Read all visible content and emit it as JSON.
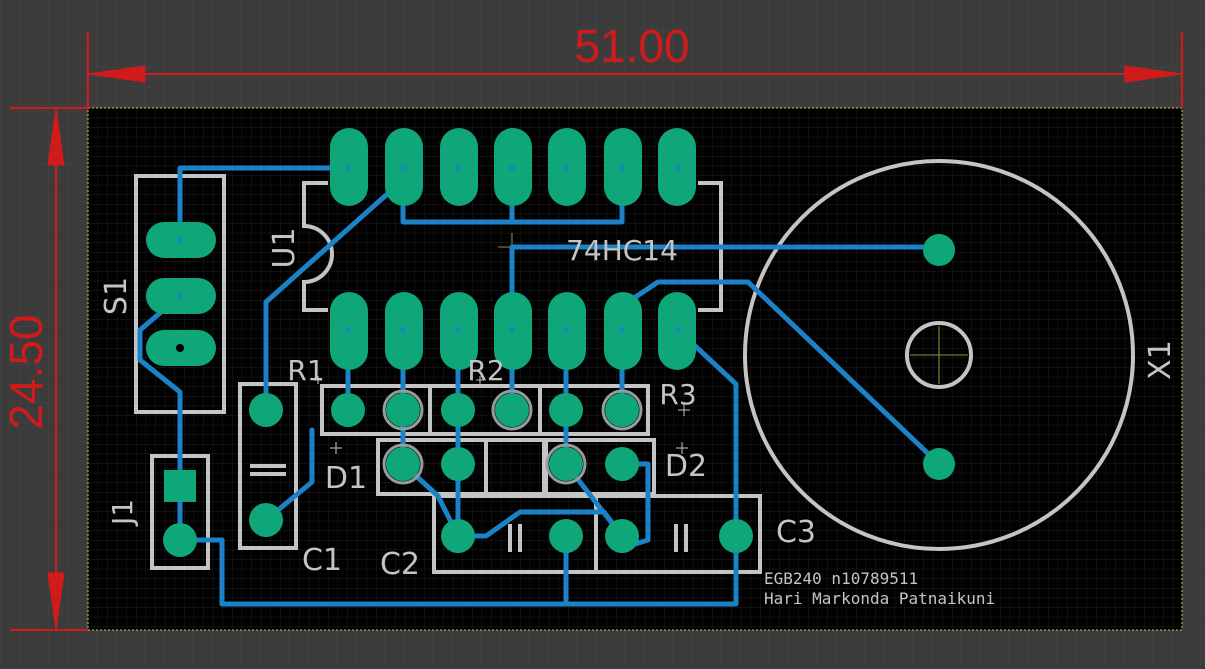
{
  "dimensions": {
    "width": "51.00",
    "height": "24.50"
  },
  "components": {
    "u1": {
      "designator": "U1",
      "value": "74HC14"
    },
    "s1": {
      "designator": "S1"
    },
    "j1": {
      "designator": "J1"
    },
    "r1": {
      "designator": "R1"
    },
    "r2": {
      "designator": "R2"
    },
    "r3": {
      "designator": "R3"
    },
    "d1": {
      "designator": "D1"
    },
    "d2": {
      "designator": "D2"
    },
    "c1": {
      "designator": "C1"
    },
    "c2": {
      "designator": "C2"
    },
    "c3": {
      "designator": "C3"
    },
    "x1": {
      "designator": "X1"
    }
  },
  "board_text": {
    "line1": "EGB240 n10789511",
    "line2": "Hari Markonda Patnaikuni"
  },
  "colors": {
    "background": "#3b3b3b",
    "board": "#000000",
    "grid": "#2c2c2c",
    "dimension": "#d11a1a",
    "silkscreen": "#c4c4c4",
    "pad": "#0fa67a",
    "trace": "#1b82c8",
    "outline": "#c8c860"
  }
}
